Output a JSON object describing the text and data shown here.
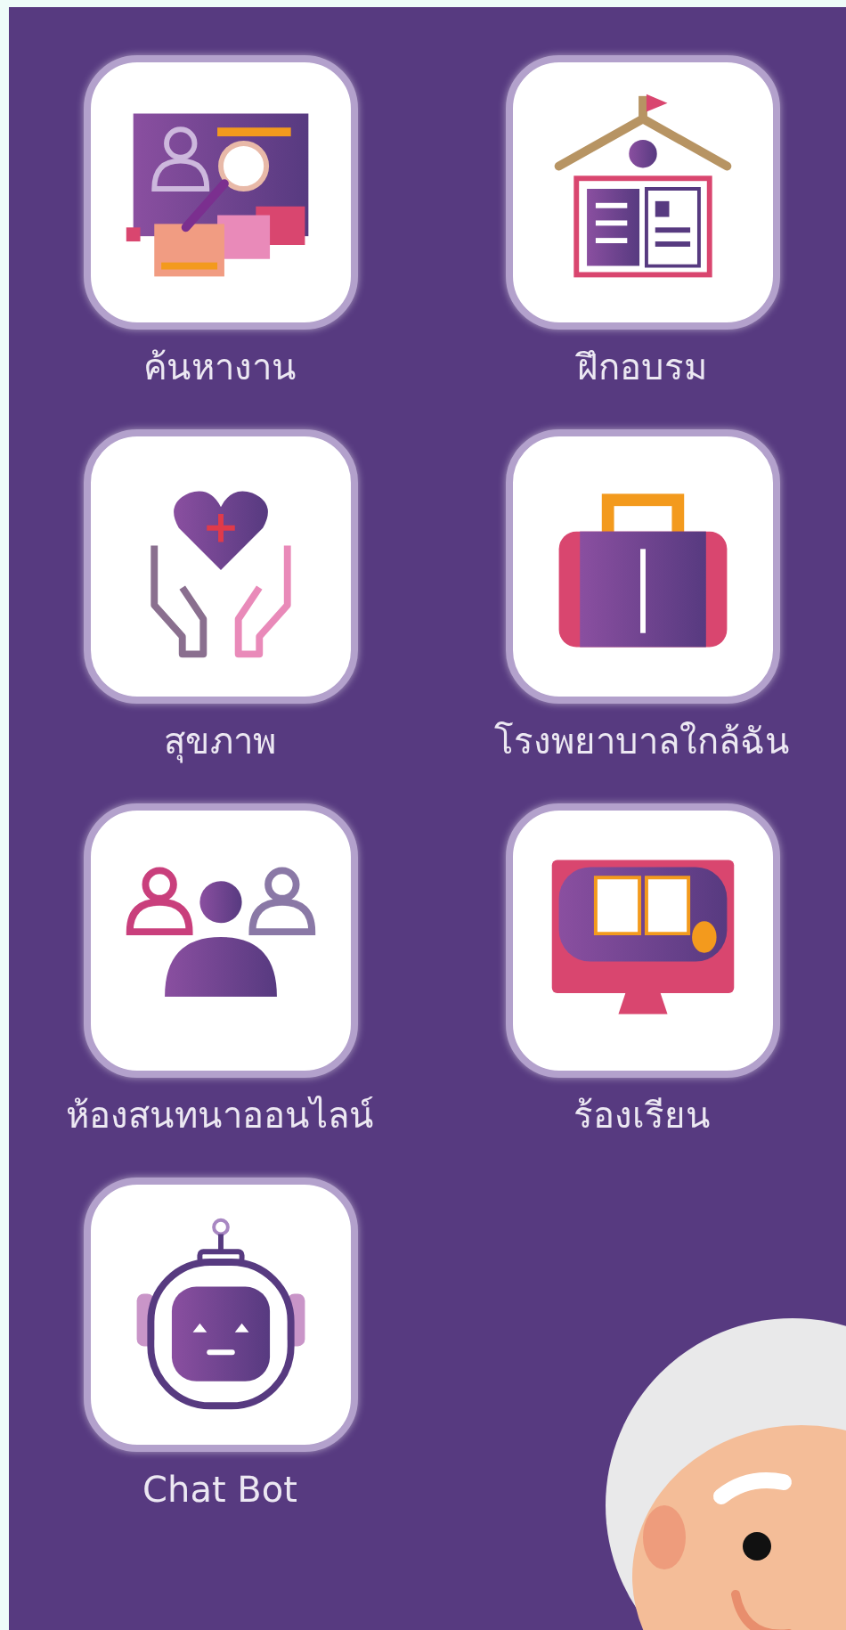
{
  "menu": [
    {
      "kind": "job-search",
      "label": "ค้นหางาน"
    },
    {
      "kind": "training",
      "label": "ฝึกอบรม"
    },
    {
      "kind": "health",
      "label": "สุขภาพ"
    },
    {
      "kind": "hospital",
      "label": "โรงพยาบาลใกล้ฉัน"
    },
    {
      "kind": "chat-room",
      "label": "ห้องสนทนาออนไลน์"
    },
    {
      "kind": "study",
      "label": "ร้องเรียน"
    },
    {
      "kind": "chat-bot",
      "label": "Chat Bot"
    }
  ]
}
